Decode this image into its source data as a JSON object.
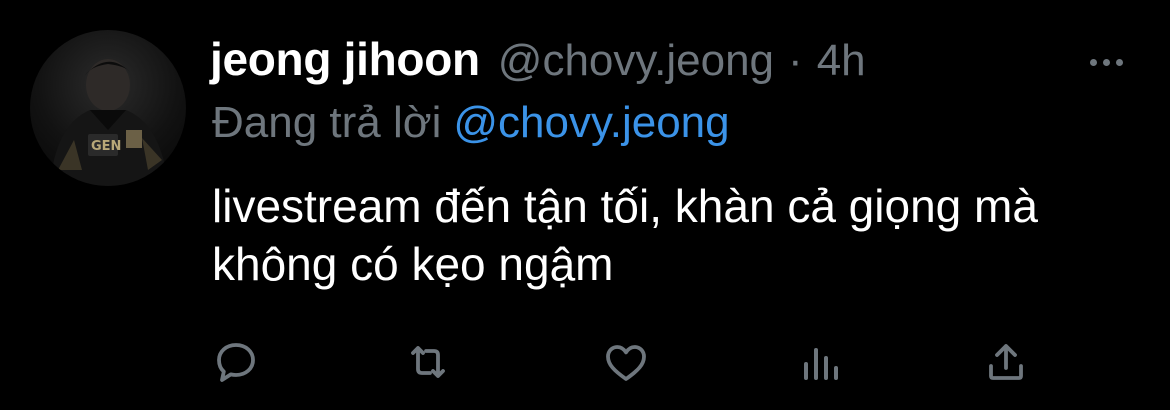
{
  "tweet": {
    "author": {
      "display_name": "jeong jihoon",
      "handle": "@chovy.jeong",
      "separator": "·",
      "time": "4h"
    },
    "reply": {
      "prefix": "Đang trả lời",
      "mention": "@chovy.jeong"
    },
    "text": "livestream đến tận tối, khàn cả giọng mà không có kẹo ngậm",
    "actions": [
      {
        "name": "reply",
        "icon": "reply-icon"
      },
      {
        "name": "retweet",
        "icon": "retweet-icon"
      },
      {
        "name": "like",
        "icon": "heart-icon"
      },
      {
        "name": "analytics",
        "icon": "analytics-icon"
      },
      {
        "name": "share",
        "icon": "share-icon"
      }
    ]
  },
  "colors": {
    "background": "#000000",
    "primary_text": "#ffffff",
    "secondary_text": "#6e767d",
    "link": "#3b93e8"
  }
}
